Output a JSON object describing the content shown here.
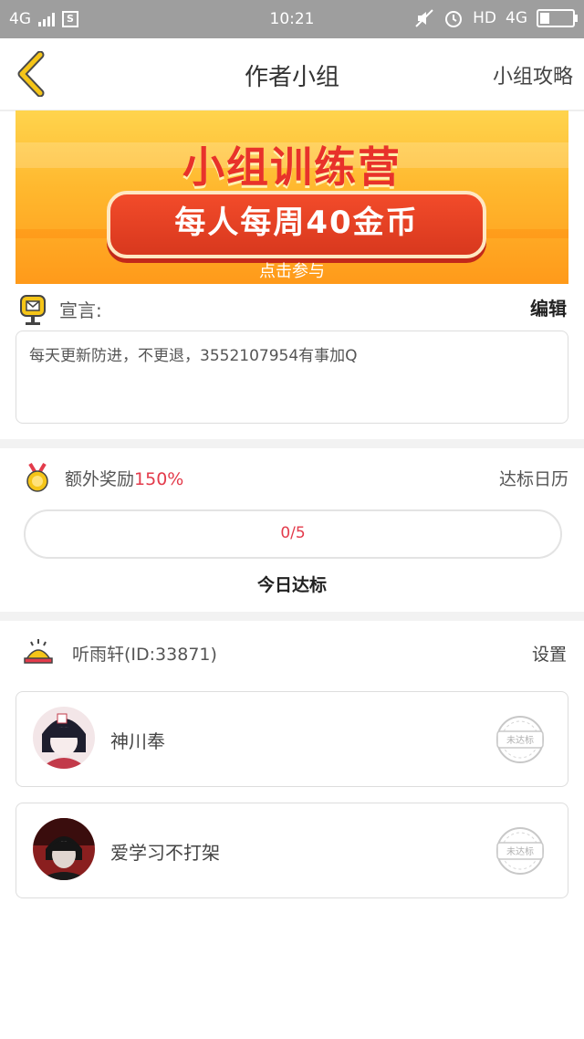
{
  "status_bar": {
    "network": "4G",
    "sim_icon": "S",
    "time": "10:21",
    "hd": "HD",
    "network_right": "4G",
    "battery_level": 0.3
  },
  "nav": {
    "title": "作者小组",
    "right_link": "小组攻略"
  },
  "banner": {
    "title": "小组训练营",
    "subtitle": "每人每周40金币",
    "cta": "点击参与"
  },
  "declaration": {
    "label": "宣言:",
    "edit": "编辑",
    "text": "每天更新防进，不更退，3552107954有事加Q"
  },
  "bonus": {
    "label": "额外奖励",
    "percent": "150%",
    "calendar": "达标日历",
    "progress_text": "0/5",
    "progress_value": 0,
    "today": "今日达标"
  },
  "group": {
    "name": "听雨轩(ID:33871)",
    "settings": "设置"
  },
  "members": [
    {
      "name": "神川奉",
      "stamp": "未达标"
    },
    {
      "name": "爱学习不打架",
      "stamp": "未达标"
    }
  ],
  "colors": {
    "status_bar": "#9e9e9e",
    "accent_red": "#e33b4b",
    "banner_orange": "#ffb82e",
    "icon_yellow": "#f5c518"
  }
}
